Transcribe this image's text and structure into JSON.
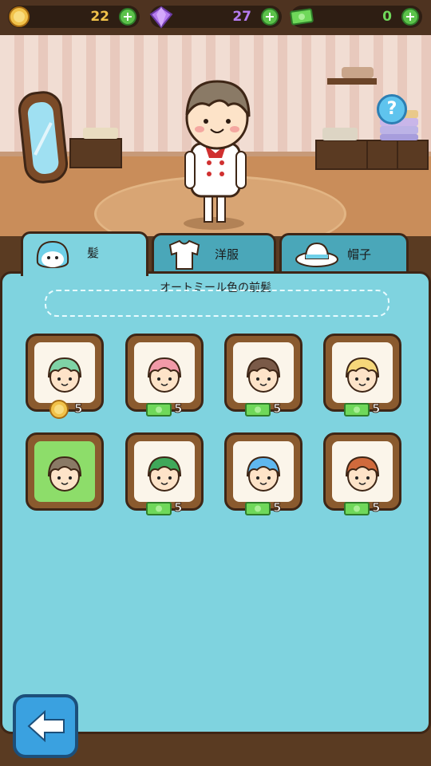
{
  "currencies": [
    {
      "icon": "coin-icon",
      "value": "22",
      "color": "#f1c24a"
    },
    {
      "icon": "gem-icon",
      "value": "27",
      "color": "#b57cf0"
    },
    {
      "icon": "cash-icon",
      "value": "0",
      "color": "#6fd85a"
    }
  ],
  "tabs": [
    {
      "label": "髪",
      "icon": "hair-icon"
    },
    {
      "label": "洋服",
      "icon": "shirt-icon"
    },
    {
      "label": "帽子",
      "icon": "hat-icon"
    }
  ],
  "selected_item_title": "オートミール色の前髪",
  "items": [
    {
      "hair_color": "#7fd3a6",
      "price_icon": "coin-icon",
      "price": "5"
    },
    {
      "hair_color": "#f19aa8",
      "price_icon": "cash-icon",
      "price": "5"
    },
    {
      "hair_color": "#7a5a48",
      "price_icon": "cash-icon",
      "price": "5"
    },
    {
      "hair_color": "#f5d77a",
      "price_icon": "cash-icon",
      "price": "5"
    },
    {
      "hair_color": "#8a7a66",
      "selected": true
    },
    {
      "hair_color": "#3fa85a",
      "price_icon": "cash-icon",
      "price": "5"
    },
    {
      "hair_color": "#5fb7ee",
      "price_icon": "cash-icon",
      "price": "5"
    },
    {
      "hair_color": "#d06a3c",
      "price_icon": "cash-icon",
      "price": "5"
    }
  ]
}
